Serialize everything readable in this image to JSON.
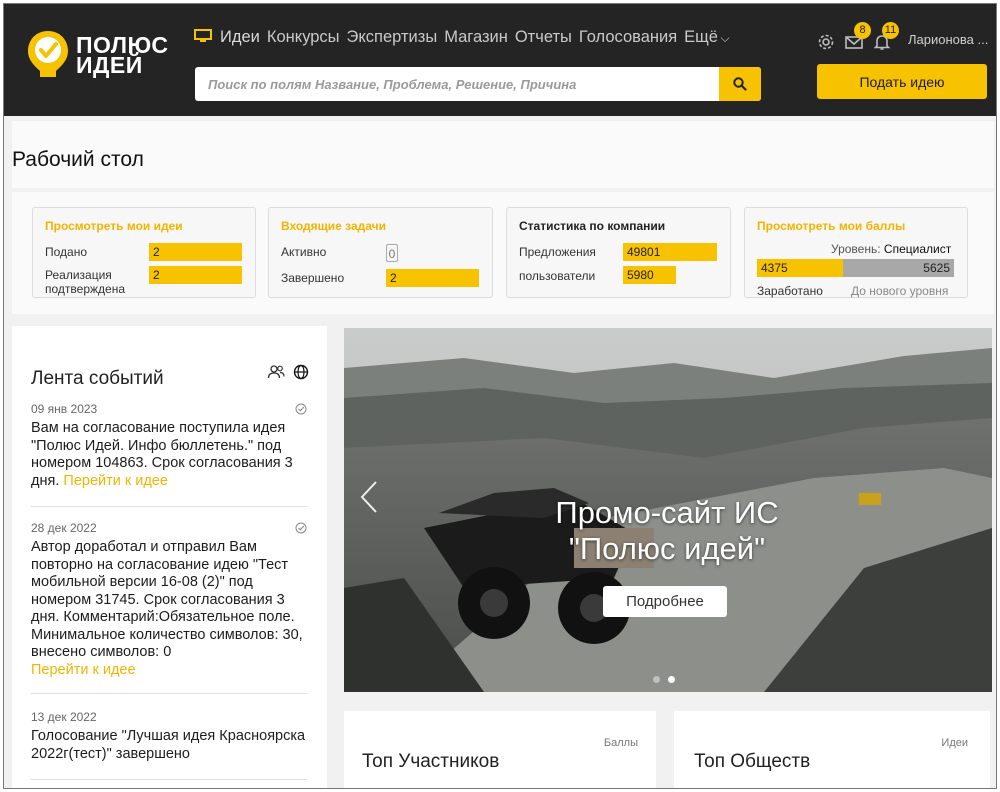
{
  "brand": {
    "line1": "ПОЛЮС",
    "line2": "ИДЕЙ",
    "accent": "#f7c200",
    "header_bg": "#242424"
  },
  "nav": {
    "icon": "monitor-icon",
    "items": [
      "Идеи",
      "Конкурсы",
      "Экспертизы",
      "Магазин",
      "Отчеты",
      "Голосования"
    ],
    "more_label": "Ещё"
  },
  "search": {
    "placeholder": "Поиск по полям Название, Проблема, Решение, Причина",
    "icon": "search-icon"
  },
  "header_icons": {
    "settings": "gear-icon",
    "mail_badge": "8",
    "bell_badge": "11"
  },
  "user": {
    "name": "Ларионова ..."
  },
  "submit_label": "Подать идею",
  "page_title": "Рабочий стол",
  "cards": {
    "my_ideas": {
      "title": "Просмотреть мои идеи",
      "rows": [
        {
          "label": "Подано",
          "value": "2"
        },
        {
          "label": "Реализация подтверждена",
          "value": "2"
        }
      ]
    },
    "tasks": {
      "title": "Входящие задачи",
      "rows": [
        {
          "label": "Активно",
          "value": "0"
        },
        {
          "label": "Завершено",
          "value": "2"
        }
      ]
    },
    "company": {
      "title": "Статистика по компании",
      "rows": [
        {
          "label": "Предложения",
          "value": "49801"
        },
        {
          "label": "пользователи",
          "value": "5980"
        }
      ]
    },
    "points": {
      "title": "Просмотреть мои баллы",
      "level_label": "Уровень:",
      "level_value": "Специалист",
      "earned": "4375",
      "to_next": "5625",
      "earned_label": "Заработано",
      "next_label": "До нового уровня"
    }
  },
  "feed": {
    "title": "Лента событий",
    "items": [
      {
        "date": "09 янв 2023",
        "text": "Вам на согласование поступила идея \"Полюс Идей. Инфо бюллетень.\" под номером 104863. Срок согласования 3 дня.",
        "link": "Перейти к идее"
      },
      {
        "date": "28 дек 2022",
        "text": "Автор доработал и отправил Вам повторно на согласование идею \"Тест мобильной версии 16-08 (2)\" под номером 31745. Срок согласования 3 дня. Комментарий:Обязательное поле. Минимальное количество символов: 30, внесено символов: 0",
        "link": "Перейти к идее"
      },
      {
        "date": "13 дек 2022",
        "text": "Голосование \"Лучшая идея Красноярска 2022г(тест)\" завершено",
        "link": ""
      }
    ]
  },
  "banner": {
    "title_line1": "Промо-сайт ИС",
    "title_line2": "\"Полюс идей\"",
    "button": "Подробнее"
  },
  "bottom": {
    "left_title": "Топ Участников",
    "left_hint": "Баллы",
    "right_title": "Топ Обществ",
    "right_hint": "Идеи"
  }
}
